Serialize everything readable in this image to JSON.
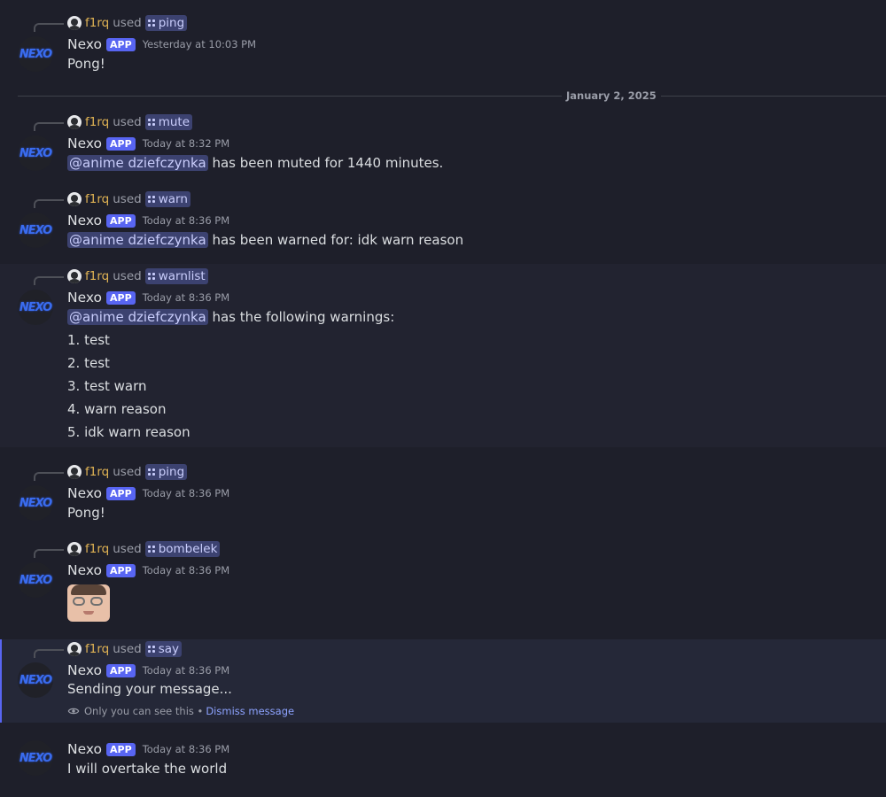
{
  "bot": {
    "name": "Nexo",
    "tag": "APP",
    "logo_text": "NEXO"
  },
  "user": {
    "name": "f1rq",
    "used": "used"
  },
  "divider": {
    "label": "January 2, 2025"
  },
  "messages": [
    {
      "command": "ping",
      "timestamp": "Yesterday at 10:03 PM",
      "text": "Pong!"
    },
    {
      "command": "mute",
      "timestamp": "Today at 8:32 PM",
      "mention": "@anime dziefczynka",
      "text": " has been muted for 1440 minutes."
    },
    {
      "command": "warn",
      "timestamp": "Today at 8:36 PM",
      "mention": "@anime dziefczynka",
      "text": " has been warned for: idk warn reason"
    },
    {
      "command": "warnlist",
      "timestamp": "Today at 8:36 PM",
      "mention": "@anime dziefczynka",
      "text": " has the following warnings:",
      "list": [
        "1. test",
        "2. test",
        "3. test warn",
        "4. warn reason",
        "5. idk warn reason"
      ]
    },
    {
      "command": "ping",
      "timestamp": "Today at 8:36 PM",
      "text": "Pong!"
    },
    {
      "command": "bombelek",
      "timestamp": "Today at 8:36 PM"
    },
    {
      "command": "say",
      "timestamp": "Today at 8:36 PM",
      "text": "Sending your message...",
      "note": "Only you can see this •",
      "dismiss": "Dismiss message"
    },
    {
      "timestamp": "Today at 8:36 PM",
      "text": "I will overtake the world"
    }
  ]
}
